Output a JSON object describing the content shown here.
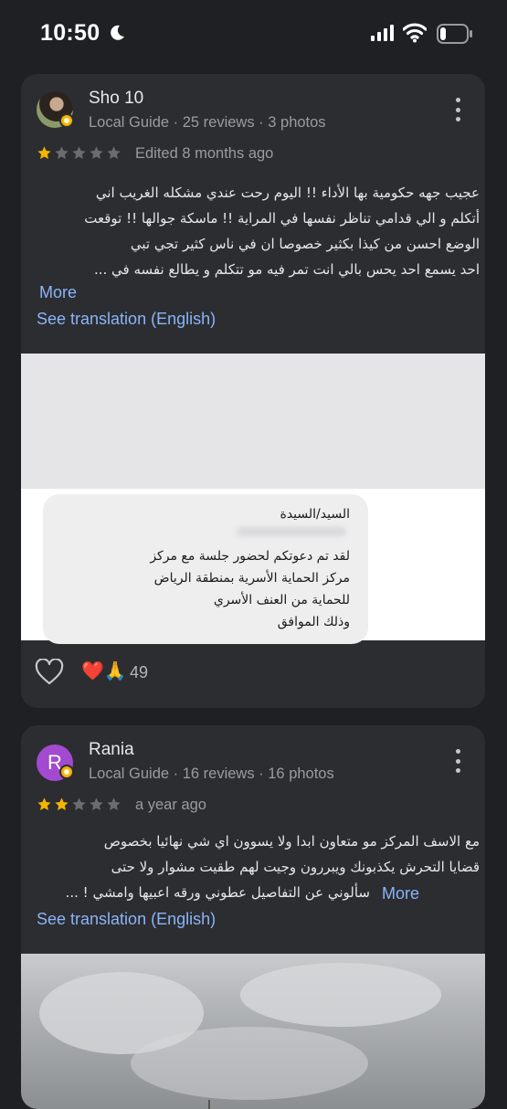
{
  "status_bar": {
    "time": "10:50"
  },
  "reviews": [
    {
      "author": "Sho 10",
      "meta": "Local Guide · 25 reviews · 3 photos",
      "rating": 1,
      "date": "Edited 8 months ago",
      "text_lines": [
        "عجيب جهه حكومية بها الأداء !! اليوم رحت عندي مشكله الغريب اني",
        "أتكلم و الي قدامي تناظر نفسها في المراية !! ماسكة جوالها !! توقعت",
        "الوضع احسن من كيذا بكثير خصوصا ان في ناس كثير تجي تبي",
        "احد يسمع احد يحس بالي انت تمر فيه مو تتكلم و يطالع نفسه في ..."
      ],
      "more_label": "More",
      "translate_label": "See translation (English)",
      "photo_text_lines": [
        "السيد/السيدة",
        "لقد تم دعوتكم لحضور جلسة مع مركز",
        "مركز الحماية الأسرية بمنطقة الرياض",
        "للحماية من العنف الأسري",
        "وذلك الموافق"
      ],
      "reactions": "❤️🙏",
      "reaction_count": "49"
    },
    {
      "author": "Rania",
      "avatar_letter": "R",
      "meta": "Local Guide · 16 reviews · 16 photos",
      "rating": 2,
      "date": "a year ago",
      "text_lines": [
        "مع الاسف المركز مو متعاون ابدا ولا يسوون اي شي نهائيا بخصوص",
        "قضايا التحرش يكذبونك ويبررون وجيت لهم طقيت مشوار ولا حتى",
        "سألوني عن التفاصيل عطوني ورقه اعبيها وامشي ! ..."
      ],
      "more_label": "More",
      "translate_label": "See translation (English)"
    }
  ],
  "colors": {
    "background": "#1f2024",
    "card": "#2c2d31",
    "link": "#8ab4f8",
    "star_filled": "#f4b400",
    "star_empty": "#6b6c70",
    "avatar_rania": "#a24ad0"
  },
  "icons": [
    "moon-icon",
    "signal-icon",
    "wifi-icon",
    "battery-icon",
    "more-vert-icon",
    "star-icon",
    "heart-outline-icon",
    "local-guide-badge-icon"
  ]
}
